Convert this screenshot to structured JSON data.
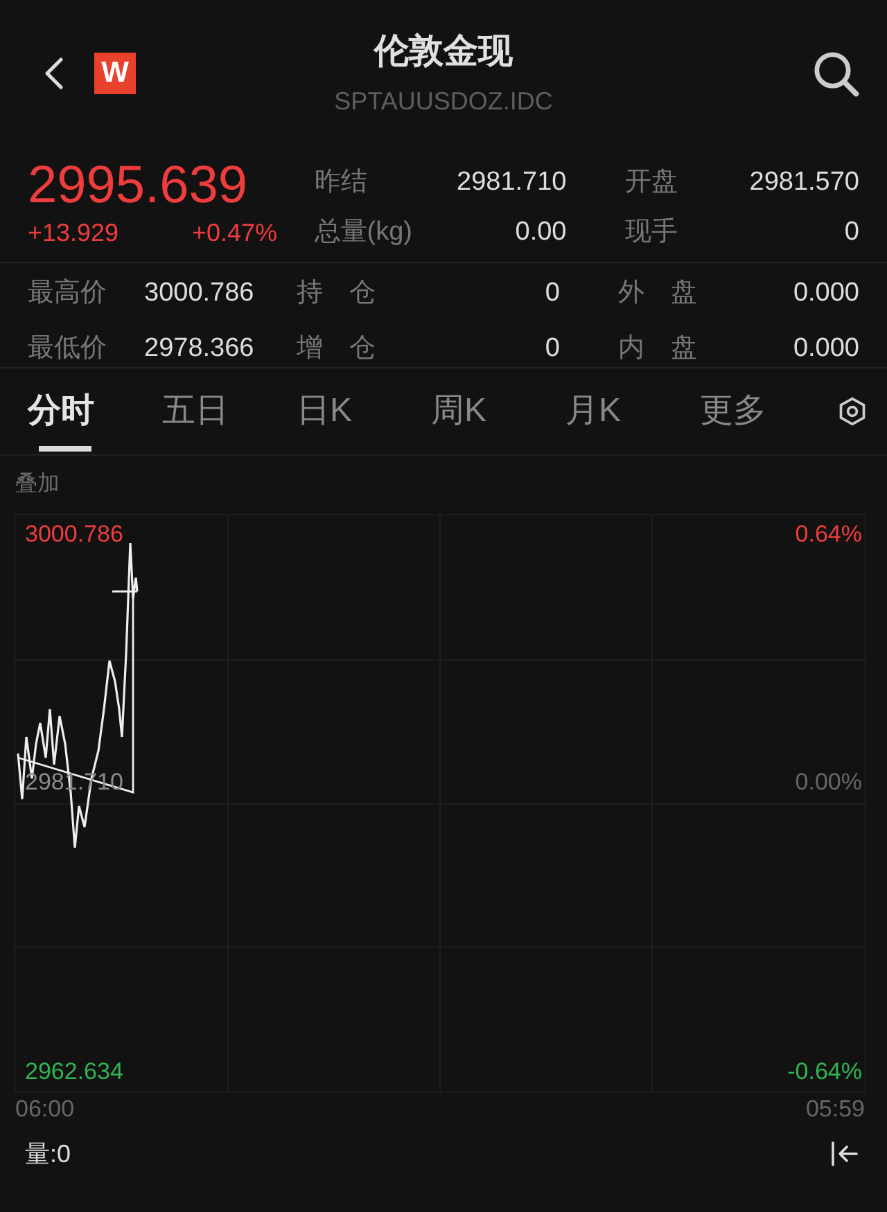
{
  "header": {
    "title": "伦敦金现",
    "subtitle": "SPTAUUSDOZ.IDC",
    "logo": "W"
  },
  "quote": {
    "price": "2995.639",
    "change": "+13.929",
    "change_pct": "+0.47%"
  },
  "summary_stats": [
    {
      "label": "昨结",
      "value": "2981.710"
    },
    {
      "label": "开盘",
      "value": "2981.570"
    },
    {
      "label": "总量(kg)",
      "value": "0.00"
    },
    {
      "label": "现手",
      "value": "0"
    }
  ],
  "detail_stats": [
    {
      "label": "最高价",
      "value": "3000.786"
    },
    {
      "label": "持　仓",
      "value": "0"
    },
    {
      "label": "外　盘",
      "value": "0.000"
    },
    {
      "label": "最低价",
      "value": "2978.366"
    },
    {
      "label": "增　仓",
      "value": "0"
    },
    {
      "label": "内　盘",
      "value": "0.000"
    }
  ],
  "tabs": [
    {
      "label": "分时",
      "selected": true
    },
    {
      "label": "五日",
      "selected": false
    },
    {
      "label": "日K",
      "selected": false
    },
    {
      "label": "周K",
      "selected": false
    },
    {
      "label": "月K",
      "selected": false
    },
    {
      "label": "更多",
      "selected": false
    }
  ],
  "overlay_label": "叠加",
  "chart": {
    "y_max": "3000.786",
    "y_mid": "2981.710",
    "y_min": "2962.634",
    "pct_max": "0.64%",
    "pct_mid": "0.00%",
    "pct_min": "-0.64%",
    "x_start": "06:00",
    "x_end": "05:59"
  },
  "volume": "量:0"
}
